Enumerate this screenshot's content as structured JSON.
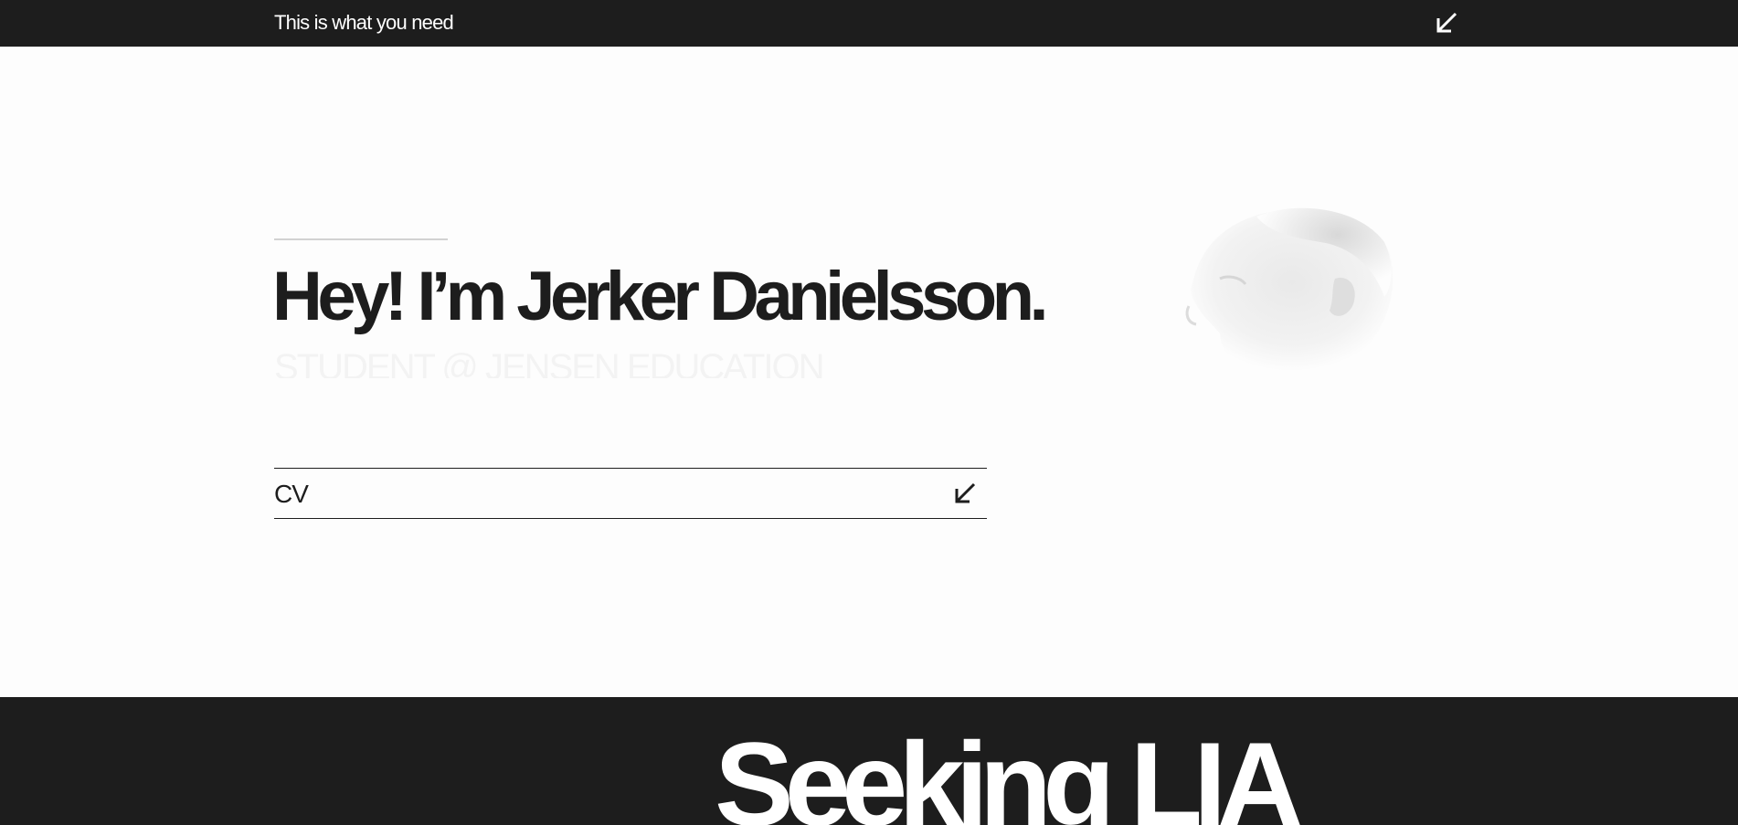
{
  "header": {
    "title": "This is what you need",
    "menu_icon": "arrow-down-left-icon"
  },
  "hero": {
    "heading": "Hey! I’m Jerker Danielsson.",
    "subtitle": "STUDENT @ JENSEN EDUCATION",
    "portrait": "portrait-photo"
  },
  "cv": {
    "label": "CV",
    "icon": "arrow-down-left-icon"
  },
  "banner": {
    "heading": "Seeking LIA"
  },
  "colors": {
    "dark": "#1d1d1d",
    "background": "#fdfdfd",
    "light_text": "#ffffff",
    "rule": "#d2d2d2"
  }
}
